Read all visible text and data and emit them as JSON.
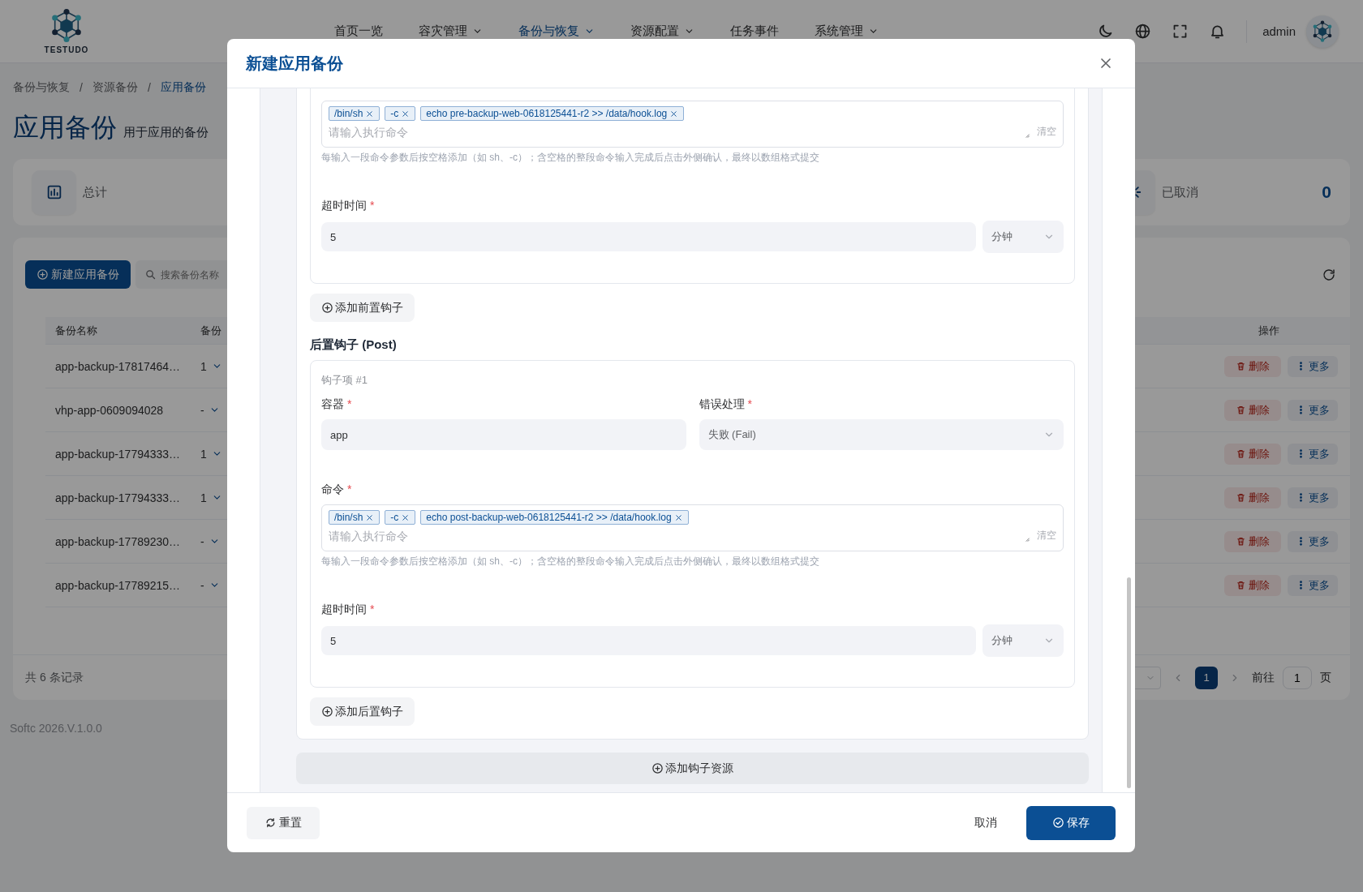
{
  "header": {
    "logo_text": "TESTUDO",
    "nav": [
      {
        "label": "首页一览",
        "selected": false,
        "has_menu": false
      },
      {
        "label": "容灾管理",
        "selected": false,
        "has_menu": true
      },
      {
        "label": "备份与恢复",
        "selected": true,
        "has_menu": true
      },
      {
        "label": "资源配置",
        "selected": false,
        "has_menu": true
      },
      {
        "label": "任务事件",
        "selected": false,
        "has_menu": false
      },
      {
        "label": "系统管理",
        "selected": false,
        "has_menu": true
      }
    ],
    "user": "admin"
  },
  "breadcrumb": {
    "items": [
      {
        "label": "备份与恢复",
        "current": false
      },
      {
        "label": "资源备份",
        "current": false
      },
      {
        "label": "应用备份",
        "current": true
      }
    ],
    "separators": [
      "/",
      "/"
    ]
  },
  "page": {
    "title": "应用备份",
    "subtitle": "用于应用的备份"
  },
  "stats": [
    {
      "kind": "total",
      "label": "总计"
    },
    {
      "kind": "cancelled",
      "label": "已取消",
      "value": "0"
    }
  ],
  "toolbar": {
    "create_button": "新建应用备份",
    "search_placeholder": "搜索备份名称"
  },
  "table": {
    "columns": [
      "备份名称",
      "备份",
      "操作"
    ],
    "rows": [
      {
        "name": "app-backup-17817464…",
        "column_2": "1",
        "actions": [
          {
            "kind": "delete",
            "label": "删除"
          },
          {
            "kind": "more",
            "label": "更多"
          }
        ]
      },
      {
        "name": "vhp-app-0609094028",
        "column_2": "-",
        "actions": [
          {
            "kind": "delete",
            "label": "删除"
          },
          {
            "kind": "more",
            "label": "更多"
          }
        ]
      },
      {
        "name": "app-backup-17794333…",
        "column_2": "1",
        "actions": [
          {
            "kind": "delete",
            "label": "删除"
          },
          {
            "kind": "more",
            "label": "更多"
          }
        ]
      },
      {
        "name": "app-backup-17794333…",
        "column_2": "1",
        "actions": [
          {
            "kind": "delete",
            "label": "删除"
          },
          {
            "kind": "more",
            "label": "更多"
          }
        ]
      },
      {
        "name": "app-backup-17789230…",
        "column_2": "-",
        "actions": [
          {
            "kind": "delete",
            "label": "删除"
          },
          {
            "kind": "more",
            "label": "更多"
          }
        ]
      },
      {
        "name": "app-backup-17789215…",
        "column_2": "-",
        "actions": [
          {
            "kind": "delete",
            "label": "删除"
          },
          {
            "kind": "more",
            "label": "更多"
          }
        ]
      }
    ]
  },
  "pagination": {
    "total": "共 6 条记录",
    "pages": [
      {
        "label": "1",
        "selected": true
      }
    ],
    "goto_label": "前往",
    "goto_value": "1",
    "page_suffix": "页"
  },
  "version": "Softc 2026.V.1.0.0",
  "dialog": {
    "title": "新建应用备份",
    "pre_hook": {
      "command": {
        "tags": [
          "/bin/sh",
          "-c",
          "echo pre-backup-web-0618125441-r2 >> /data/hook.log"
        ],
        "placeholder": "请输入执行命令",
        "clear": "清空",
        "help": "每输入一段命令参数后按空格添加（如 sh、-c）；含空格的整段命令输入完成后点击外侧确认，最终以数组格式提交"
      },
      "timeout": {
        "label": "超时时间",
        "mark": "*",
        "value": "5",
        "unit": "分钟"
      }
    },
    "add_pre_button": "添加前置钩子",
    "post_title": "后置钩子 (Post)",
    "post_hooks": [
      {
        "item_label": "钩子项 #1",
        "container": {
          "label": "容器",
          "mark": "*",
          "value": "app"
        },
        "error_handling": {
          "label": "错误处理",
          "mark": "*",
          "value": "失败 (Fail)"
        },
        "command": {
          "label": "命令",
          "mark": "*",
          "tags": [
            "/bin/sh",
            "-c",
            "echo post-backup-web-0618125441-r2 >> /data/hook.log"
          ],
          "placeholder": "请输入执行命令",
          "clear": "清空",
          "help": "每输入一段命令参数后按空格添加（如 sh、-c）；含空格的整段命令输入完成后点击外侧确认，最终以数组格式提交"
        },
        "timeout": {
          "label": "超时时间",
          "mark": "*",
          "value": "5",
          "unit": "分钟"
        }
      }
    ],
    "add_post_button": "添加后置钩子",
    "add_resource_button": "添加钩子资源",
    "reset_button": "重置",
    "cancel_button": "取消",
    "save_button": "保存"
  }
}
